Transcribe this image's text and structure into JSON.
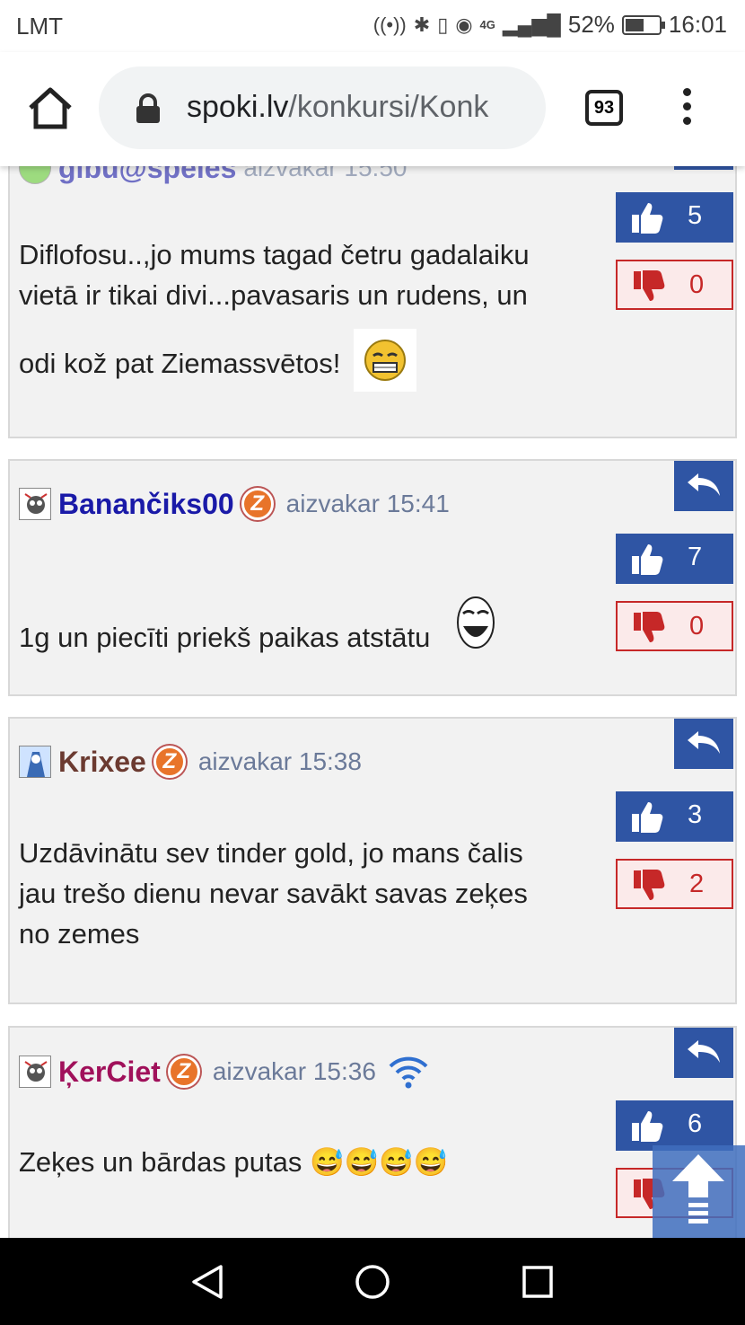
{
  "status_bar": {
    "carrier": "LMT",
    "network": "4G",
    "battery": "52%",
    "time": "16:01",
    "icons": [
      "hotspot-icon",
      "bluetooth-icon",
      "vibrate-icon",
      "eye-comfort-icon",
      "signal-icon",
      "battery-icon"
    ]
  },
  "browser": {
    "url_host": "spoki.lv",
    "url_path": "/konkursi/Konk",
    "tab_count": "93"
  },
  "comments": [
    {
      "partial_user": "gibu@speles",
      "partial_time": "aizvakar 15:50",
      "text_line1": "Diflofosu..,jo mums tagad četru gadalaiku",
      "text_line2": "vietā ir tikai divi...pavasaris un rudens, un",
      "text_line3": "odi kož pat Ziemassvētos!",
      "likes": "5",
      "dislikes": "0"
    },
    {
      "username": "Banančiks00",
      "badge": "Z",
      "time": "aizvakar 15:41",
      "text": "1g un piecīti priekš paikas atstātu",
      "likes": "7",
      "dislikes": "0",
      "name_color": "#1a1aa8"
    },
    {
      "username": "Krixee",
      "badge": "Z",
      "time": "aizvakar 15:38",
      "text_line1": "Uzdāvinātu sev tinder gold, jo mans čalis",
      "text_line2": "jau trešo dienu nevar savākt savas zeķes",
      "text_line3": "no zemes",
      "likes": "3",
      "dislikes": "2",
      "name_color": "#6b3a30"
    },
    {
      "username": "ĶerCiet",
      "badge": "Z",
      "time": "aizvakar 15:36",
      "text": "Zeķes un bārdas putas 😅😅😅😅",
      "likes": "6",
      "name_color": "#a0105a"
    }
  ],
  "colors": {
    "like_blue": "#2f55a4",
    "dislike_red": "#c62828",
    "card_bg": "#f2f2f2"
  }
}
